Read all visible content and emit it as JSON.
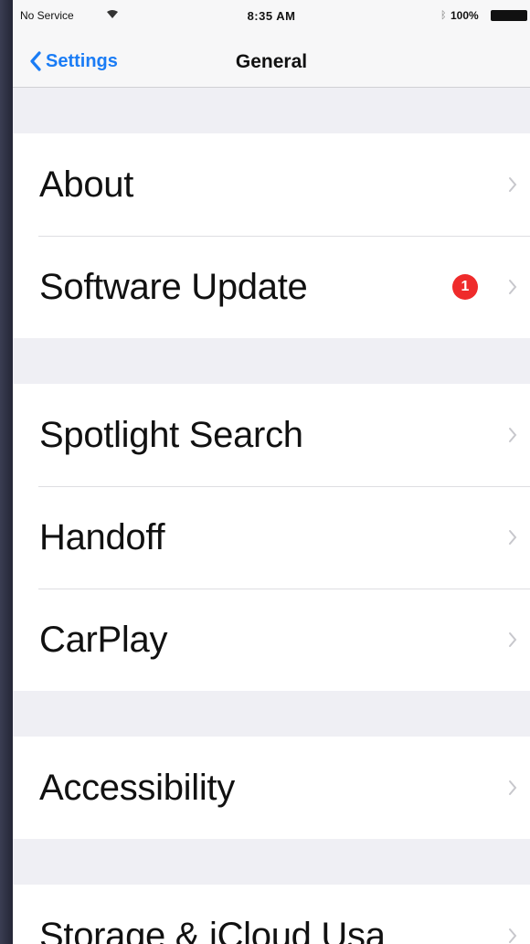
{
  "status_bar": {
    "carrier": "No Service",
    "wifi_icon": "wifi-icon",
    "time": "8:35 AM",
    "bluetooth_icon": "bluetooth-icon",
    "battery_percent": "100%",
    "battery_icon": "battery-full-icon"
  },
  "nav": {
    "back_label": "Settings",
    "back_icon": "chevron-left-icon",
    "title": "General"
  },
  "accent_color": "#1a7cf5",
  "badge_color": "#ef2b2b",
  "groups": [
    {
      "items": [
        {
          "label": "About"
        },
        {
          "label": "Software Update",
          "badge": "1"
        }
      ]
    },
    {
      "items": [
        {
          "label": "Spotlight Search"
        },
        {
          "label": "Handoff"
        },
        {
          "label": "CarPlay"
        }
      ]
    },
    {
      "items": [
        {
          "label": "Accessibility"
        }
      ]
    },
    {
      "items": [
        {
          "label": "Storage & iCloud Usa"
        }
      ]
    }
  ]
}
